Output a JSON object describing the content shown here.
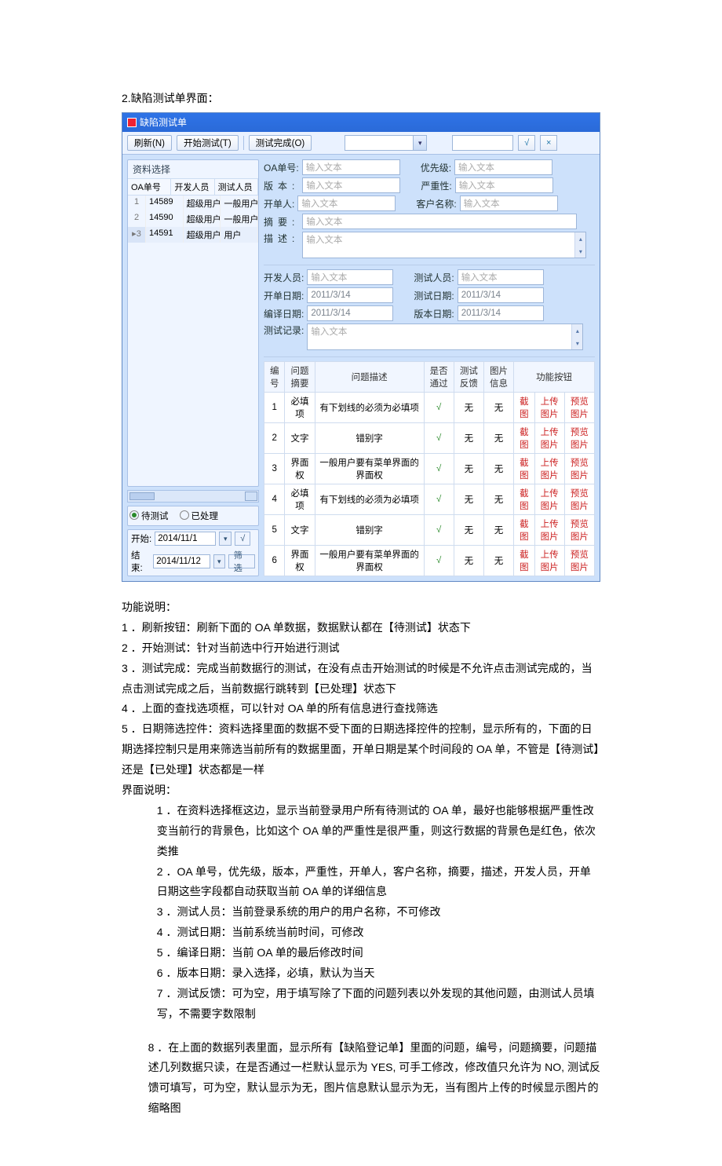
{
  "page_heading": "2.缺陷测试单界面：",
  "window_title": "缺陷测试单",
  "toolbar": {
    "refresh": "刷新(N)",
    "start": "开始测试(T)",
    "done": "测试完成(O)",
    "combo1": "",
    "combo2": "",
    "check_icon": "√",
    "close_icon": "×"
  },
  "sidebar": {
    "title": "资料选择",
    "head1": "OA单号",
    "head2": "开发人员",
    "head3": "测试人员",
    "rows": [
      {
        "idx": "1",
        "num": "14589",
        "dev": "超级用户",
        "test": "一般用户"
      },
      {
        "idx": "2",
        "num": "14590",
        "dev": "超级用户",
        "test": "一般用户"
      },
      {
        "idx": "3",
        "num": "14591",
        "dev": "超级用户",
        "test": "用户"
      }
    ],
    "radio_pending": "待测试",
    "radio_done": "已处理",
    "start_label": "开始:",
    "start_date": "2014/11/1",
    "end_label": "结束:",
    "end_date": "2014/11/12",
    "y": "√",
    "filter": "筛选"
  },
  "form": {
    "oa_no": "OA单号:",
    "priority": "优先级:",
    "version": "版本:",
    "severity": "严重性:",
    "creator": "开单人:",
    "customer": "客户名称:",
    "summary": "摘要:",
    "desc": "描述:",
    "dev": "开发人员:",
    "tester": "测试人员:",
    "create_date": "开单日期:",
    "test_date": "测试日期:",
    "compile_date": "编译日期:",
    "ver_date": "版本日期:",
    "test_rec": "测试记录:",
    "ph": "输入文本",
    "d1": "2011/3/14"
  },
  "grid": {
    "h1": "编号",
    "h2": "问题摘要",
    "h3": "问题描述",
    "h4": "是否通过",
    "h5": "测试反馈",
    "h6": "图片信息",
    "h7": "功能按钮",
    "none": "无",
    "chk": "√",
    "b_shot": "截图",
    "b_up": "上传图片",
    "b_prev": "预览图片",
    "rows": [
      {
        "n": "1",
        "s": "必填项",
        "d": "有下划线的必须为必填项"
      },
      {
        "n": "2",
        "s": "文字",
        "d": "错别字"
      },
      {
        "n": "3",
        "s": "界面权",
        "d": "一般用户要有菜单界面的界面权"
      },
      {
        "n": "4",
        "s": "必填项",
        "d": "有下划线的必须为必填项"
      },
      {
        "n": "5",
        "s": "文字",
        "d": "错别字"
      },
      {
        "n": "6",
        "s": "界面权",
        "d": "一般用户要有菜单界面的界面权"
      }
    ]
  },
  "doc": {
    "func_head": "功能说明：",
    "f1": "1  ．刷新按钮：刷新下面的 OA 单数据，数据默认都在【待测试】状态下",
    "f2": "2  ．开始测试：针对当前选中行开始进行测试",
    "f3": "3  ．测试完成：完成当前数据行的测试，在没有点击开始测试的时候是不允许点击测试完成的，当点击测试完成之后，当前数据行跳转到【已处理】状态下",
    "f4": "4  ．上面的查找选项框，可以针对 OA 单的所有信息进行查找筛选",
    "f5": "5  ．日期筛选控件：资料选择里面的数据不受下面的日期选择控件的控制，显示所有的，下面的日期选择控制只是用来筛选当前所有的数据里面，开单日期是某个时间段的 OA 单，不管是【待测试】还是【已处理】状态都是一样",
    "ui_head": "界面说明：",
    "u1": "1 ．在资料选择框这边，显示当前登录用户所有待测试的 OA 单，最好也能够根据严重性改变当前行的背景色，比如这个 OA 单的严重性是很严重，则这行数据的背景色是红色，依次类推",
    "u2": "2 ．OA 单号，优先级，版本，严重性，开单人，客户名称，摘要，描述，开发人员，开单日期这些字段都自动获取当前 OA 单的详细信息",
    "u3": "3 ．测试人员：当前登录系统的用户的用户名称，不可修改",
    "u4": "4 ．测试日期：当前系统当前时间，可修改",
    "u5": "5 ．编译日期：当前 OA 单的最后修改时间",
    "u6": "6 ．版本日期：录入选择，必填，默认为当天",
    "u7": "7 ．测试反馈：可为空，用于填写除了下面的问题列表以外发现的其他问题，由测试人员填写，不需要字数限制",
    "u8": "8        ．在上面的数据列表里面，显示所有【缺陷登记单】里面的问题，编号，问题摘要，问题描述几列数据只读，在是否通过一栏默认显示为 YES, 可手工修改，修改值只允许为 NO, 测试反馈可填写，可为空，默认显示为无，图片信息默认显示为无，当有图片上传的时候显示图片的缩略图"
  }
}
